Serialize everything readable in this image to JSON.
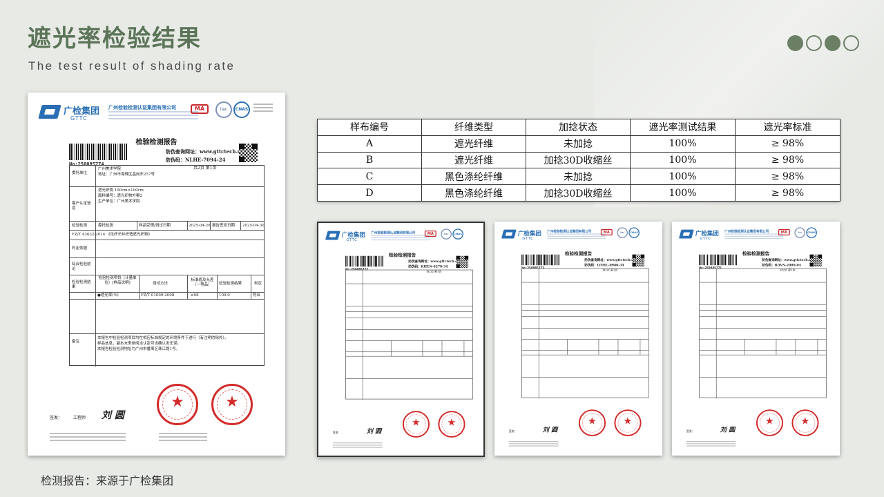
{
  "header": {
    "title": "遮光率检验结果",
    "subtitle": "The test result of shading rate"
  },
  "pager_dots": [
    {
      "filled": true
    },
    {
      "filled": false
    },
    {
      "filled": true
    },
    {
      "filled": false
    }
  ],
  "report_common": {
    "logo_cn": "广检集团",
    "logo_en": "GTTC",
    "org_name": "广州检验检测认证集团有限公司",
    "cert_ma": "MA",
    "cert_ilac": "ilac",
    "cert_cnas": "CNAS",
    "doc_title": "检验检测报告",
    "antifake_site_label": "防伪查询网址：www.gttctech.com",
    "signer_label": "签发：",
    "signature": "刘 圆"
  },
  "main_report": {
    "report_no": "No:250085774",
    "antifake_code": "防伪码：NLHE-7094-24",
    "page_info": "共2页 第1页",
    "client_label": "委托单位",
    "client_name": "广州美术学院",
    "client_address": "地址：广州市海珠区昌岗东257号",
    "sample_label": "客户认定信息",
    "sample_line1": "遮光织物    100cm×100cm",
    "sample_line2": "面料编号：遮光织物方案2",
    "sample_line3": "生产单位：广州美术学院",
    "category_label": "检验检测",
    "category_value": "委托检测",
    "received_label": "样品受理/测试日期",
    "received_date": "2025-04-28",
    "issue_label": "报告签发日期",
    "issue_date": "2025-04-30",
    "standard": "FZ/T 43032-2014 《化纤长丝织造遮光织物》",
    "judgement_label": "判定依据",
    "conclusion_label": "综合检验结论",
    "items_label": "检验检测结果",
    "col_item": "检验检测项目（计量单位）[样品说明]",
    "col_method": "测试方法",
    "col_requirement": "标准值及允差（一等品）",
    "col_result": "检验检测结果",
    "col_judgement": "判定",
    "row_item": "●遮光率(%)",
    "row_method": "FZ/T 01009-2008",
    "row_requirement": "≥98",
    "row_result": "100.0",
    "row_judgement": "符合",
    "remarks_label": "备注",
    "remark_line1": "本报告中检验检测项目均在相应标准规定的环境条件下进行（有注明的除外）。",
    "remark_line2": "样品信息，副本未来参阅当认定可当确认发无误。",
    "remark_line3": "本报告检验检测地址为广州市番禺区珠江路1号。",
    "signer_title": "工程师"
  },
  "small_reports": [
    {
      "report_no": "No:250085772",
      "antifake_code": "防伪码：KHEN-6270-34",
      "page_info": "共2页 第1页"
    },
    {
      "report_no": "No:250085773",
      "antifake_code": "防伪码：QTMC-0980-34",
      "page_info": "共2页 第1页"
    },
    {
      "report_no": "No:250085771",
      "antifake_code": "防伪码：RDVN-2009-04",
      "page_info": "共2页 第1页"
    }
  ],
  "result_table": {
    "headers": [
      "样布编号",
      "纤维类型",
      "加捻状态",
      "遮光率测试结果",
      "遮光率标准"
    ],
    "rows": [
      [
        "A",
        "遮光纤维",
        "未加捻",
        "100%",
        "≥ 98%"
      ],
      [
        "B",
        "遮光纤维",
        "加捻30D收缩丝",
        "100%",
        "≥ 98%"
      ],
      [
        "C",
        "黑色涤纶纤维",
        "未加捻",
        "100%",
        "≥ 98%"
      ],
      [
        "D",
        "黑色涤纶纤维",
        "加捻30D收缩丝",
        "100%",
        "≥ 98%"
      ]
    ]
  },
  "footer": {
    "source_note": "检测报告：来源于广检集团"
  }
}
